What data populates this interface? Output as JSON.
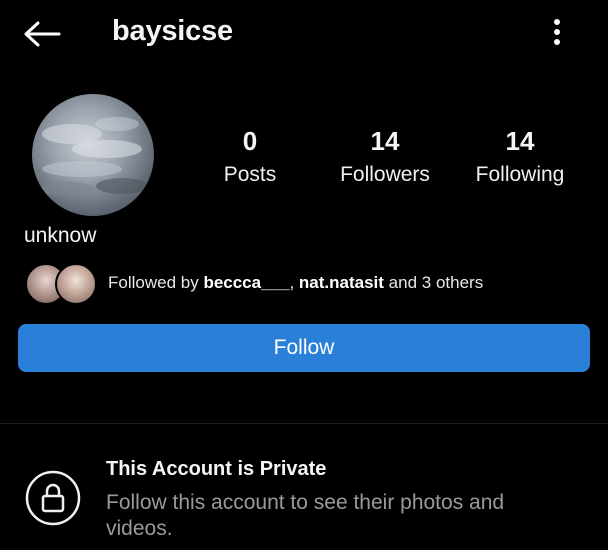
{
  "header": {
    "back_icon": "arrow-left-icon",
    "username": "baysicse",
    "more_icon": "more-vertical-icon"
  },
  "profile": {
    "avatar_icon": "sky-clouds-photo",
    "display_name": "unknow",
    "stats": [
      {
        "value": "0",
        "label": "Posts"
      },
      {
        "value": "14",
        "label": "Followers"
      },
      {
        "value": "14",
        "label": "Following"
      }
    ]
  },
  "followed_by": {
    "prefix": "Followed by ",
    "user1": "beccca___",
    "separator": ", ",
    "user2": "nat.natasit",
    "suffix": " and 3 others"
  },
  "follow_button": {
    "label": "Follow",
    "color": "#2a7fd8"
  },
  "private_notice": {
    "icon": "lock-icon",
    "title": "This Account is Private",
    "description": "Follow this account to see their photos and videos."
  }
}
